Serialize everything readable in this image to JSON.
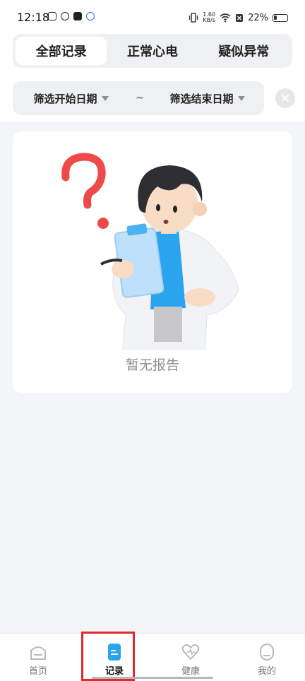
{
  "status_bar": {
    "time": "12:18",
    "net_speed_value": "1.60",
    "net_speed_unit": "KB/s",
    "battery": "22%"
  },
  "tabs": [
    {
      "label": "全部记录",
      "active": true
    },
    {
      "label": "正常心电",
      "active": false
    },
    {
      "label": "疑似异常",
      "active": false
    }
  ],
  "filter": {
    "start_label": "筛选开始日期",
    "separator": "~",
    "end_label": "筛选结束日期"
  },
  "empty_state": {
    "message": "暂无报告"
  },
  "bottom_nav": [
    {
      "label": "首页",
      "icon": "home-icon",
      "active": false
    },
    {
      "label": "记录",
      "icon": "record-icon",
      "active": true
    },
    {
      "label": "健康",
      "icon": "heart-icon",
      "active": false
    },
    {
      "label": "我的",
      "icon": "profile-icon",
      "active": false
    }
  ],
  "colors": {
    "accent": "#2ba4ee",
    "highlight": "#e02a2a",
    "muted_text": "#8a8f99",
    "background": "#f4f5f7"
  }
}
